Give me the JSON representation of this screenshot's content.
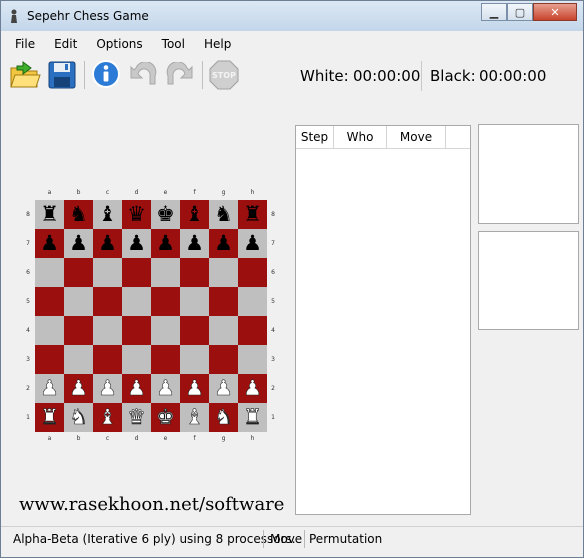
{
  "window": {
    "title": "Sepehr Chess Game"
  },
  "menu": [
    "File",
    "Edit",
    "Options",
    "Tool",
    "Help"
  ],
  "toolbar": [
    {
      "name": "open-icon",
      "color": "#e8b400"
    },
    {
      "name": "save-icon",
      "color": "#2a6fc0"
    },
    {
      "name": "info-icon",
      "color": "#2c7bd6"
    },
    {
      "name": "undo-icon",
      "color": "#b8b8b8"
    },
    {
      "name": "redo-icon",
      "color": "#b8b8b8"
    },
    {
      "name": "stop-icon",
      "color": "#c8c8c8",
      "label": "STOP"
    }
  ],
  "timers": {
    "white_label": "White:",
    "white_time": "00:00:00",
    "black_label": "Black:",
    "black_time": "00:00:00"
  },
  "board": {
    "files": [
      "a",
      "b",
      "c",
      "d",
      "e",
      "f",
      "g",
      "h"
    ],
    "ranks": [
      "8",
      "7",
      "6",
      "5",
      "4",
      "3",
      "2",
      "1"
    ],
    "rows": [
      [
        "♜",
        "♞",
        "♝",
        "♛",
        "♚",
        "♝",
        "♞",
        "♜"
      ],
      [
        "♟",
        "♟",
        "♟",
        "♟",
        "♟",
        "♟",
        "♟",
        "♟"
      ],
      [
        "",
        "",
        "",
        "",
        "",
        "",
        "",
        ""
      ],
      [
        "",
        "",
        "",
        "",
        "",
        "",
        "",
        ""
      ],
      [
        "",
        "",
        "",
        "",
        "",
        "",
        "",
        ""
      ],
      [
        "",
        "",
        "",
        "",
        "",
        "",
        "",
        ""
      ],
      [
        "♟",
        "♟",
        "♟",
        "♟",
        "♟",
        "♟",
        "♟",
        "♟"
      ],
      [
        "♜",
        "♞",
        "♝",
        "♛",
        "♚",
        "♝",
        "♞",
        "♜"
      ]
    ],
    "white_rows": [
      6,
      7
    ],
    "colors": {
      "light": "#bfbfbf",
      "dark": "#9b0f0f"
    }
  },
  "url_text": "www.rasekhoon.net/software",
  "move_table": {
    "headers": [
      "Step",
      "Who",
      "Move"
    ]
  },
  "status": {
    "engine": "Alpha-Beta (Iterative 6 ply) using 8 processors.",
    "move": "Move",
    "permutation": "Permutation"
  }
}
